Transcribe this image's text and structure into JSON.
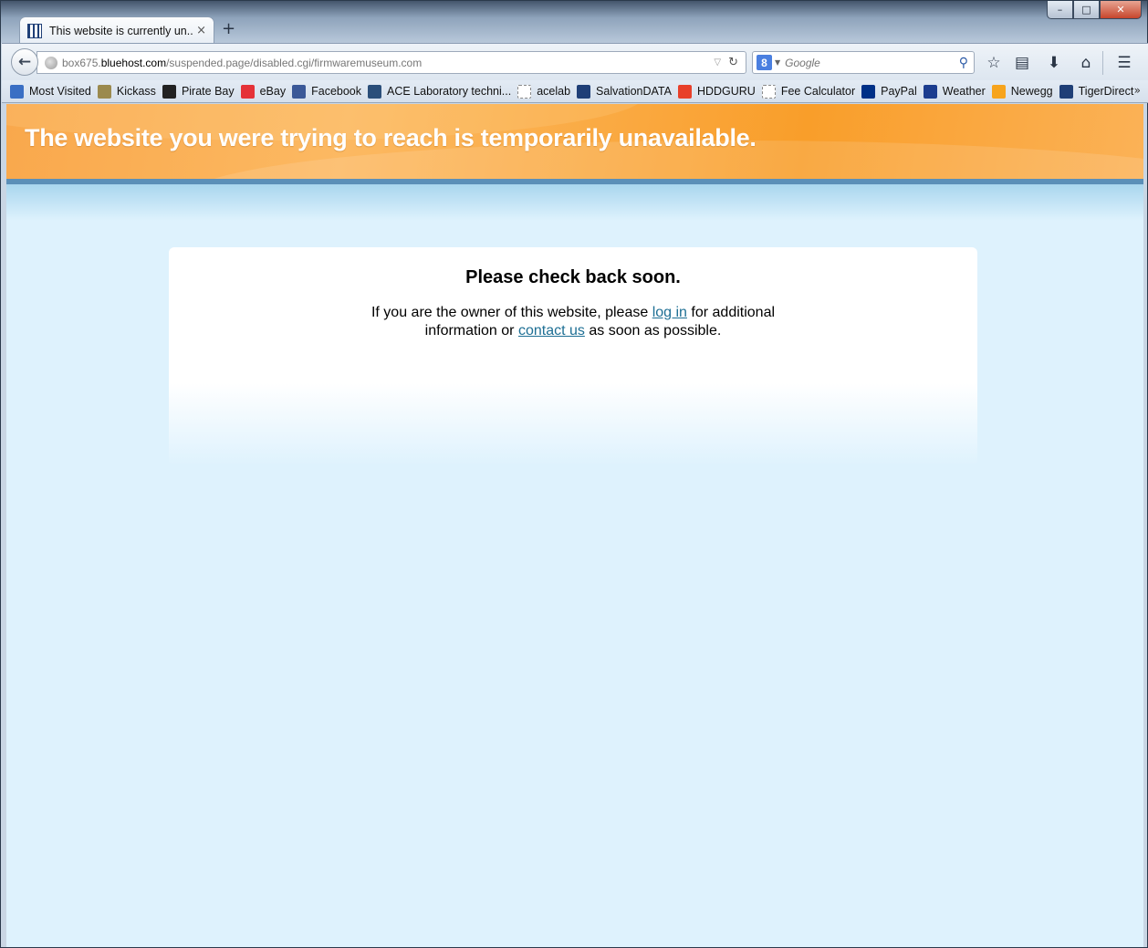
{
  "window": {
    "controls": {
      "minimize": "–",
      "maximize": "□",
      "close": "✕"
    }
  },
  "tab": {
    "title": "This website is currently un...",
    "close": "×",
    "new_tab": "+"
  },
  "navbar": {
    "back": "←",
    "url_prefix": "box675.",
    "url_host": "bluehost.com",
    "url_path": "/suspended.page/disabled.cgi/firmwaremuseum.com",
    "search_placeholder": "Google",
    "icons": [
      "back-arrow-icon",
      "globe-icon",
      "reload-icon",
      "google-icon",
      "search-icon",
      "star-icon",
      "reading-list-icon",
      "download-icon",
      "home-icon",
      "menu-icon"
    ]
  },
  "bookmarks": {
    "items": [
      {
        "label": "Most Visited",
        "icon": "most-visited-icon",
        "color": "#3a6fc4"
      },
      {
        "label": "Kickass",
        "icon": "kickass-icon",
        "color": "#9b8a4e"
      },
      {
        "label": "Pirate Bay",
        "icon": "pirate-bay-icon",
        "color": "#222222"
      },
      {
        "label": "eBay",
        "icon": "ebay-icon",
        "color": "#e53238"
      },
      {
        "label": "Facebook",
        "icon": "facebook-icon",
        "color": "#3b5998"
      },
      {
        "label": "ACE Laboratory techni...",
        "icon": "ace-lab-icon",
        "color": "#2b4f7a"
      },
      {
        "label": "acelab",
        "icon": "blank-page-icon",
        "color": "#ffffff"
      },
      {
        "label": "SalvationDATA",
        "icon": "salvationdata-icon",
        "color": "#1f3f77"
      },
      {
        "label": "HDDGURU",
        "icon": "hddguru-icon",
        "color": "#e8402a"
      },
      {
        "label": "Fee Calculator",
        "icon": "blank-page-icon",
        "color": "#ffffff"
      },
      {
        "label": "PayPal",
        "icon": "paypal-icon",
        "color": "#003087"
      },
      {
        "label": "Weather",
        "icon": "weather-icon",
        "color": "#1c3d8f"
      },
      {
        "label": "Newegg",
        "icon": "newegg-icon",
        "color": "#f7a41d"
      },
      {
        "label": "TigerDirect",
        "icon": "tigerdirect-icon",
        "color": "#1f3f77"
      }
    ],
    "more": "»"
  },
  "page": {
    "banner_title": "The website you were trying to reach is temporarily unavailable.",
    "heading": "Please check back soon.",
    "body_part1": "If you are the owner of this website, please",
    "login_link": "log in",
    "body_part2": "for additional information or",
    "contact_link": "contact us",
    "body_part3": "as soon as possible.",
    "colors": {
      "banner": "#f9a84c",
      "background": "#def2fd",
      "link": "#1e6f94"
    }
  }
}
